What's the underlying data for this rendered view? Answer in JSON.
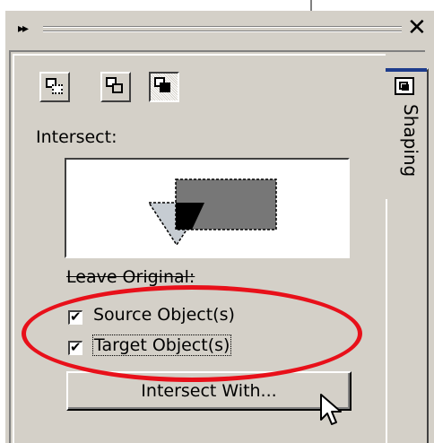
{
  "panel": {
    "title_grip_icon": "double-chevron-right-icon",
    "close_icon": "close-icon",
    "mode_buttons": [
      {
        "name": "weld",
        "icon": "weld-icon",
        "pressed": false
      },
      {
        "name": "trim",
        "icon": "trim-icon",
        "pressed": false
      },
      {
        "name": "intersect",
        "icon": "intersect-icon",
        "pressed": true
      }
    ],
    "heading": "Intersect:",
    "leave_original_label": "Leave Original:",
    "source_checkbox": {
      "label": "Source Object(s)",
      "checked": true
    },
    "target_checkbox": {
      "label": "Target Object(s)",
      "checked": true
    },
    "action_button_label": "Intersect With..."
  },
  "side_tab": {
    "label": "Shaping",
    "icon": "shaping-docker-icon"
  },
  "colors": {
    "annotation": "#e8101a",
    "face": "#d4d0c8",
    "tab_accent": "#1e3c8c"
  }
}
